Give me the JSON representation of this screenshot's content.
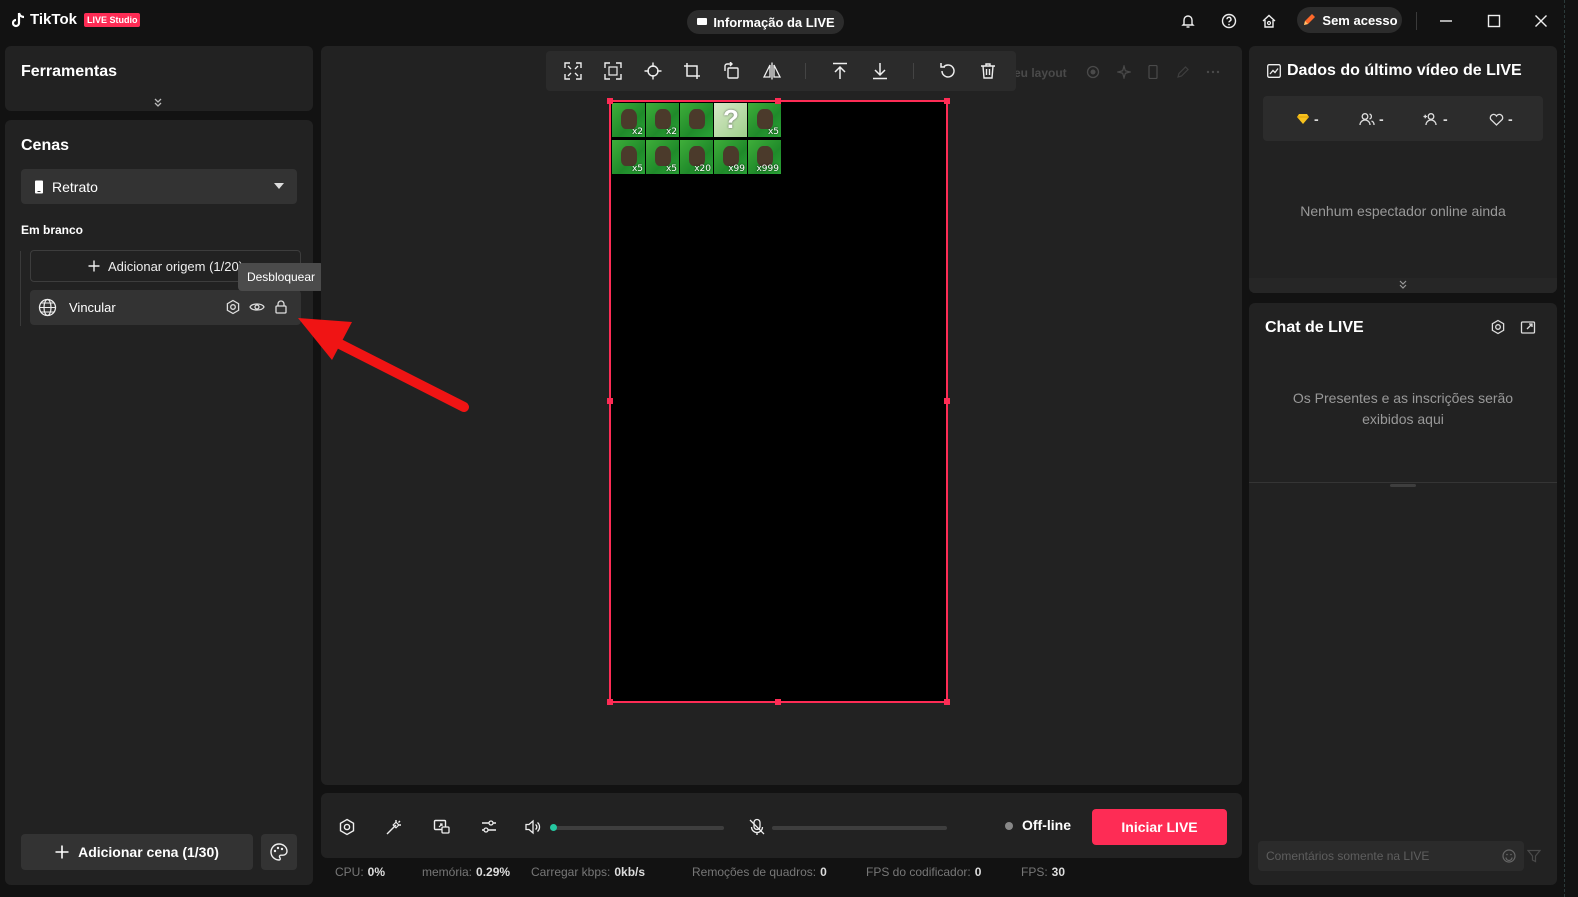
{
  "titlebar": {
    "app_name": "TikTok",
    "app_badge": "LIVE Studio",
    "live_info_label": "Informação da LIVE",
    "access_label": "Sem acesso"
  },
  "tools": {
    "title": "Ferramentas"
  },
  "scenes": {
    "title": "Cenas",
    "orientation": "Retrato",
    "scene_name": "Em branco",
    "add_source_label": "Adicionar origem (1/20)",
    "sources": [
      {
        "label": "Vincular",
        "icon": "globe-icon"
      }
    ],
    "tooltip": "Desbloquear",
    "add_scene_label": "Adicionar cena (1/30)"
  },
  "canvas": {
    "toolbar": [
      "fit-screen-icon",
      "full-screen-icon",
      "center-icon",
      "crop-icon",
      "rotate-icon",
      "flip-icon",
      "move-up-icon",
      "move-down-icon",
      "reset-icon",
      "delete-icon"
    ],
    "hidden_toolbar_text": "eu layout",
    "preview_tiles": [
      {
        "count": "x2",
        "type": "creature"
      },
      {
        "count": "x2",
        "type": "creature"
      },
      {
        "count": "",
        "type": "creature"
      },
      {
        "count": "",
        "type": "question"
      },
      {
        "count": "x5",
        "type": "creature"
      },
      {
        "count": "x5",
        "type": "creature"
      },
      {
        "count": "x5",
        "type": "creature"
      },
      {
        "count": "x20",
        "type": "creature"
      },
      {
        "count": "x99",
        "type": "creature"
      },
      {
        "count": "x999",
        "type": "creature"
      }
    ]
  },
  "controls": {
    "status": "Off-line",
    "go_live_label": "Iniciar LIVE",
    "volume_level": 0.02,
    "mic_level": 0
  },
  "stats": [
    {
      "label": "CPU:",
      "value": "0%"
    },
    {
      "label": "memória:",
      "value": "0.29%"
    },
    {
      "label": "Carregar kbps:",
      "value": "0kb/s"
    },
    {
      "label": "Remoções de quadros:",
      "value": "0"
    },
    {
      "label": "FPS do codificador:",
      "value": "0"
    },
    {
      "label": "FPS:",
      "value": "30"
    }
  ],
  "last_live": {
    "title": "Dados do último vídeo de LIVE",
    "metrics": [
      {
        "icon": "diamond-icon",
        "value": "-"
      },
      {
        "icon": "viewers-icon",
        "value": "-"
      },
      {
        "icon": "new-follower-icon",
        "value": "-"
      },
      {
        "icon": "heart-icon",
        "value": "-"
      }
    ],
    "empty_text": "Nenhum espectador online ainda"
  },
  "chat": {
    "title": "Chat de LIVE",
    "empty_text": "Os Presentes e as inscrições serão exibidos aqui",
    "input_placeholder": "Comentários somente na LIVE"
  },
  "colors": {
    "accent": "#fe2c55",
    "volume": "#25c7a0",
    "panel": "#222222",
    "background": "#121212"
  }
}
